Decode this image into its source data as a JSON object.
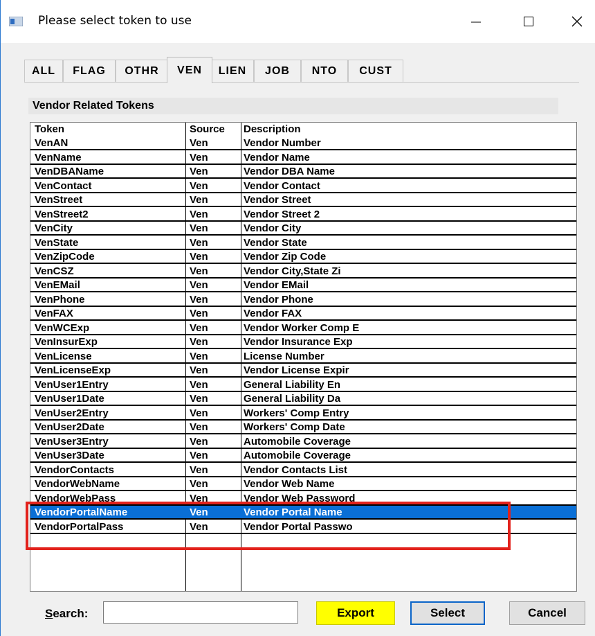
{
  "window": {
    "title": "Please select token to use"
  },
  "tabs": [
    "ALL",
    "FLAG",
    "OTHR",
    "VEN",
    "LIEN",
    "JOB",
    "NTO",
    "CUST"
  ],
  "active_tab": "VEN",
  "panel": {
    "title": "Vendor Related Tokens"
  },
  "columns": {
    "token": "Token",
    "source": "Source",
    "description": "Description"
  },
  "rows": [
    {
      "token": "VenAN",
      "source": "Ven",
      "description": "Vendor Number"
    },
    {
      "token": "VenName",
      "source": "Ven",
      "description": "Vendor Name"
    },
    {
      "token": "VenDBAName",
      "source": "Ven",
      "description": "Vendor DBA Name"
    },
    {
      "token": "VenContact",
      "source": "Ven",
      "description": "Vendor Contact"
    },
    {
      "token": "VenStreet",
      "source": "Ven",
      "description": "Vendor Street"
    },
    {
      "token": "VenStreet2",
      "source": "Ven",
      "description": "Vendor Street 2"
    },
    {
      "token": "VenCity",
      "source": "Ven",
      "description": "Vendor City"
    },
    {
      "token": "VenState",
      "source": "Ven",
      "description": "Vendor State"
    },
    {
      "token": "VenZipCode",
      "source": "Ven",
      "description": "Vendor Zip Code"
    },
    {
      "token": "VenCSZ",
      "source": "Ven",
      "description": "Vendor City,State Zi"
    },
    {
      "token": "VenEMail",
      "source": "Ven",
      "description": "Vendor EMail"
    },
    {
      "token": "VenPhone",
      "source": "Ven",
      "description": "Vendor Phone"
    },
    {
      "token": "VenFAX",
      "source": "Ven",
      "description": "Vendor FAX"
    },
    {
      "token": "VenWCExp",
      "source": "Ven",
      "description": "Vendor Worker Comp E"
    },
    {
      "token": "VenInsurExp",
      "source": "Ven",
      "description": "Vendor Insurance Exp"
    },
    {
      "token": "VenLicense",
      "source": "Ven",
      "description": "License Number"
    },
    {
      "token": "VenLicenseExp",
      "source": "Ven",
      "description": "Vendor License Expir"
    },
    {
      "token": "VenUser1Entry",
      "source": "Ven",
      "description": "General Liability En"
    },
    {
      "token": "VenUser1Date",
      "source": "Ven",
      "description": "General Liability Da"
    },
    {
      "token": "VenUser2Entry",
      "source": "Ven",
      "description": "Workers' Comp Entry"
    },
    {
      "token": "VenUser2Date",
      "source": "Ven",
      "description": "Workers' Comp Date"
    },
    {
      "token": "VenUser3Entry",
      "source": "Ven",
      "description": "Automobile Coverage"
    },
    {
      "token": "VenUser3Date",
      "source": "Ven",
      "description": "Automobile Coverage"
    },
    {
      "token": "VendorContacts",
      "source": "Ven",
      "description": "Vendor Contacts List"
    },
    {
      "token": "VendorWebName",
      "source": "Ven",
      "description": "Vendor Web Name"
    },
    {
      "token": "VendorWebPass",
      "source": "Ven",
      "description": "Vendor Web Password"
    },
    {
      "token": "VendorPortalName",
      "source": "Ven",
      "description": "Vendor Portal Name"
    },
    {
      "token": "VendorPortalPass",
      "source": "Ven",
      "description": "Vendor Portal Passwo"
    }
  ],
  "selected_row_index": 26,
  "search": {
    "label_prefix": "S",
    "label_rest": "earch:",
    "value": ""
  },
  "buttons": {
    "export": "Export",
    "select": "Select",
    "cancel": "Cancel"
  },
  "colors": {
    "selection": "#0a6fd6",
    "export_button": "#ffff00",
    "highlight_box": "#e2221c"
  }
}
